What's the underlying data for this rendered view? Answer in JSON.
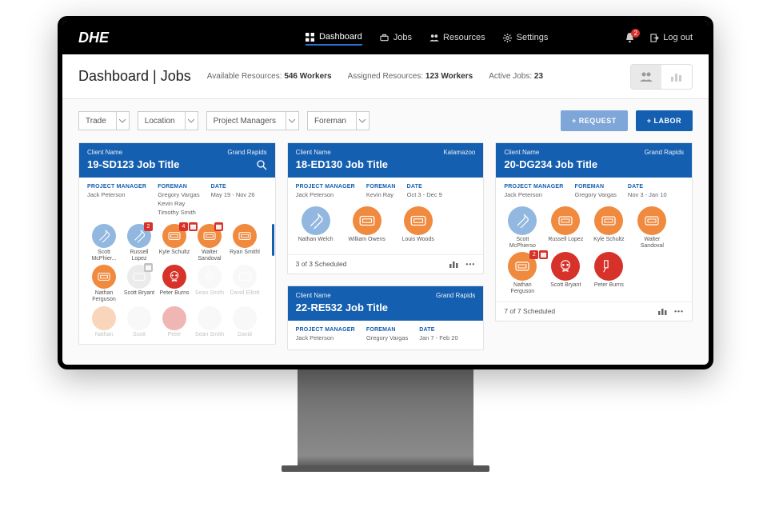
{
  "brand": "DHE",
  "nav": {
    "items": [
      {
        "label": "Dashboard",
        "active": true
      },
      {
        "label": "Jobs"
      },
      {
        "label": "Resources"
      },
      {
        "label": "Settings"
      }
    ],
    "notif_count": "2",
    "logout": "Log out"
  },
  "header": {
    "title": "Dashboard | Jobs",
    "avail_lbl": "Available Resources:",
    "avail_val": "546 Workers",
    "assigned_lbl": "Assigned Resources:",
    "assigned_val": "123 Workers",
    "active_lbl": "Active Jobs:",
    "active_val": "23"
  },
  "filters": {
    "trade": "Trade",
    "location": "Location",
    "pm": "Project Managers",
    "foreman": "Foreman",
    "request": "+ REQUEST",
    "labor": "+ LABOR"
  },
  "cards": [
    {
      "client": "Client Name",
      "city": "Grand Rapids",
      "title": "19-SD123 Job Title",
      "search": true,
      "pm_lbl": "PROJECT MANAGER",
      "pm": "Jack Peterson",
      "foreman_lbl": "FOREMAN",
      "foreman": [
        "Gregory Vargas",
        "Kevin Ray",
        "Timothy Smith"
      ],
      "date_lbl": "DATE",
      "date": "May 19 - Nov 26",
      "avatars_row1": [
        {
          "name": "Scott McPhier...",
          "color": "blue",
          "icon": "wrench"
        },
        {
          "name": "Russell Lopez",
          "color": "blue",
          "icon": "wrench",
          "badge": "2"
        },
        {
          "name": "Kyle Schultz",
          "color": "orange",
          "icon": "mask",
          "badge": "4",
          "cal": true
        },
        {
          "name": "Walter Sandoval",
          "color": "orange",
          "icon": "mask",
          "cal": true
        },
        {
          "name": "Ryan Smithl",
          "color": "orange",
          "icon": "mask"
        }
      ],
      "avatars_row2": [
        {
          "name": "Nathan Ferguson",
          "color": "orange",
          "icon": "mask"
        },
        {
          "name": "Scott Bryant",
          "color": "grey",
          "icon": "mask",
          "cal_grey": true
        },
        {
          "name": "Peter Burns",
          "color": "red",
          "icon": "skull"
        },
        {
          "name": "Sean Smith",
          "color": "grey",
          "icon": "skull",
          "faded": true
        },
        {
          "name": "David Elliott",
          "color": "grey",
          "icon": "mask",
          "faded": true
        }
      ],
      "avatars_row3_faded": [
        {
          "name": "Nathan",
          "color": "orange"
        },
        {
          "name": "Scott",
          "color": "grey"
        },
        {
          "name": "Peter",
          "color": "red"
        },
        {
          "name": "Sean Smith",
          "color": "grey"
        },
        {
          "name": "David",
          "color": "grey"
        }
      ]
    },
    {
      "client": "Client Name",
      "city": "Kalamazoo",
      "title": "18-ED130 Job Title",
      "pm_lbl": "PROJECT MANAGER",
      "pm": "Jack Peterson",
      "foreman_lbl": "FOREMAN",
      "foreman": [
        "Kevin Ray"
      ],
      "date_lbl": "DATE",
      "date": "Oct 3 - Dec 9",
      "avatars_row1": [
        {
          "name": "Nathan Welch",
          "color": "blue",
          "icon": "wrench",
          "big": true
        },
        {
          "name": "William Owens",
          "color": "orange",
          "icon": "mask",
          "big": true
        },
        {
          "name": "Louis Woods",
          "color": "orange",
          "icon": "mask",
          "big": true
        }
      ],
      "foot": "3 of 3 Scheduled"
    },
    {
      "client": "Client Name",
      "city": "Grand Rapids",
      "title": "22-RE532 Job Title",
      "pm_lbl": "PROJECT MANAGER",
      "pm": "Jack Peterson",
      "foreman_lbl": "FOREMAN",
      "foreman": [
        "Gregory Vargas"
      ],
      "date_lbl": "DATE",
      "date": "Jan 7 - Feb 20"
    },
    {
      "client": "Client Name",
      "city": "Grand Rapids",
      "title": "20-DG234 Job Title",
      "pm_lbl": "PROJECT MANAGER",
      "pm": "Jack Peterson",
      "foreman_lbl": "FOREMAN",
      "foreman": [
        "Gregory Vargas"
      ],
      "date_lbl": "DATE",
      "date": "Nov 3 - Jan 10",
      "avatars_row1": [
        {
          "name": "Scott McPhierso",
          "color": "blue",
          "icon": "wrench"
        },
        {
          "name": "Russell Lopez",
          "color": "orange",
          "icon": "mask"
        },
        {
          "name": "Kyle Schultz",
          "color": "orange",
          "icon": "mask"
        },
        {
          "name": "Walter Sandoval",
          "color": "orange",
          "icon": "mask"
        }
      ],
      "avatars_row2": [
        {
          "name": "Nathan Ferguson",
          "color": "orange",
          "icon": "mask",
          "badge": "2",
          "cal": true
        },
        {
          "name": "Scott Bryant",
          "color": "red",
          "icon": "skull"
        },
        {
          "name": "Peter Burns",
          "color": "red",
          "icon": "hammer"
        }
      ],
      "foot": "7 of 7 Scheduled"
    }
  ]
}
